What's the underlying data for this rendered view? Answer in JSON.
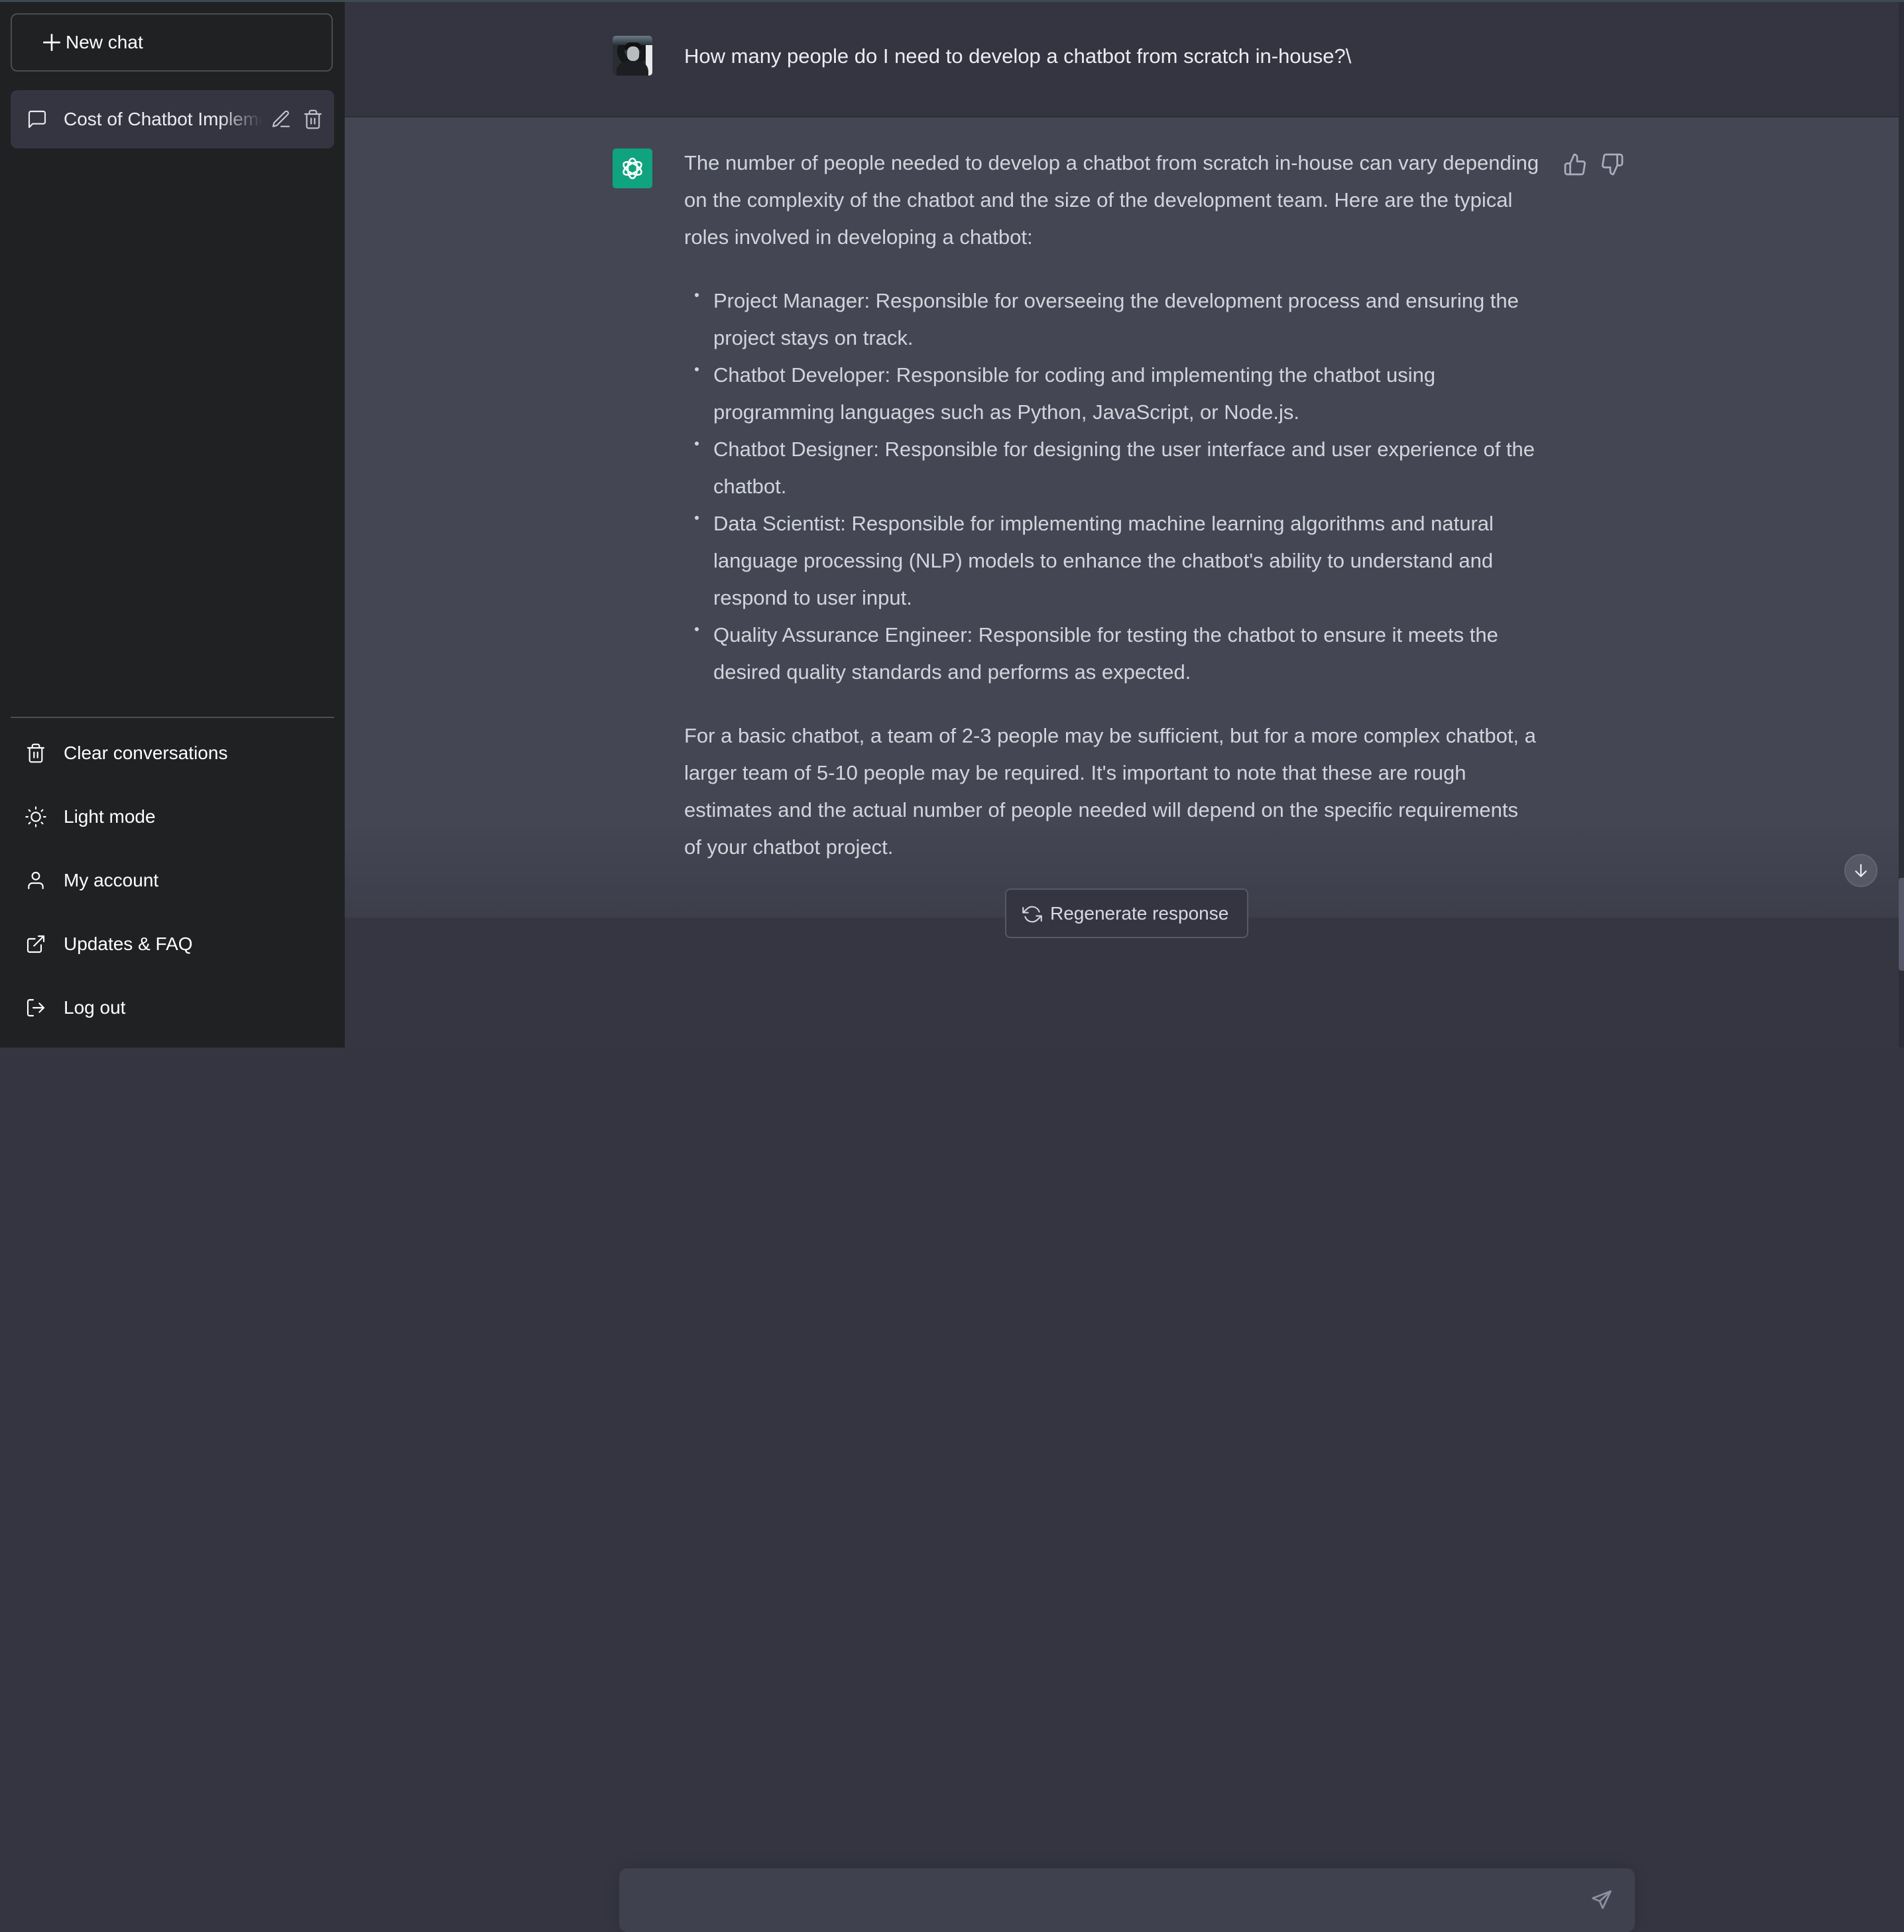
{
  "sidebar": {
    "new_chat_label": "New chat",
    "conversations": [
      {
        "title": "Cost of Chatbot Implementation",
        "active": true
      }
    ],
    "menu": [
      {
        "label": "Clear conversations",
        "icon": "trash-icon"
      },
      {
        "label": "Light mode",
        "icon": "sun-icon"
      },
      {
        "label": "My account",
        "icon": "user-icon"
      },
      {
        "label": "Updates & FAQ",
        "icon": "external-link-icon"
      },
      {
        "label": "Log out",
        "icon": "logout-icon"
      }
    ]
  },
  "conversation": {
    "user_message": "How many people do I need to develop a chatbot from scratch in-house?\\",
    "assistant": {
      "intro": "The number of people needed to develop a chatbot from scratch in-house can vary depending on the complexity of the chatbot and the size of the development team. Here are the typical roles involved in developing a chatbot:",
      "roles": [
        "Project Manager: Responsible for overseeing the development process and ensuring the project stays on track.",
        "Chatbot Developer: Responsible for coding and implementing the chatbot using programming languages such as Python, JavaScript, or Node.js.",
        "Chatbot Designer: Responsible for designing the user interface and user experience of the chatbot.",
        "Data Scientist: Responsible for implementing machine learning algorithms and natural language processing (NLP) models to enhance the chatbot's ability to understand and respond to user input.",
        "Quality Assurance Engineer: Responsible for testing the chatbot to ensure it meets the desired quality standards and performs as expected."
      ],
      "conclusion": "For a basic chatbot, a team of 2-3 people may be sufficient, but for a more complex chatbot, a larger team of 5-10 people may be required. It's important to note that these are rough estimates and the actual number of people needed will depend on the specific requirements of your chatbot project."
    }
  },
  "composer": {
    "regenerate_label": "Regenerate response",
    "input_value": "",
    "input_placeholder": ""
  },
  "colors": {
    "sidebar_bg": "#202123",
    "user_row_bg": "#343541",
    "assistant_row_bg": "#444654",
    "brand_green": "#10a37f",
    "input_bg": "#40414f"
  }
}
